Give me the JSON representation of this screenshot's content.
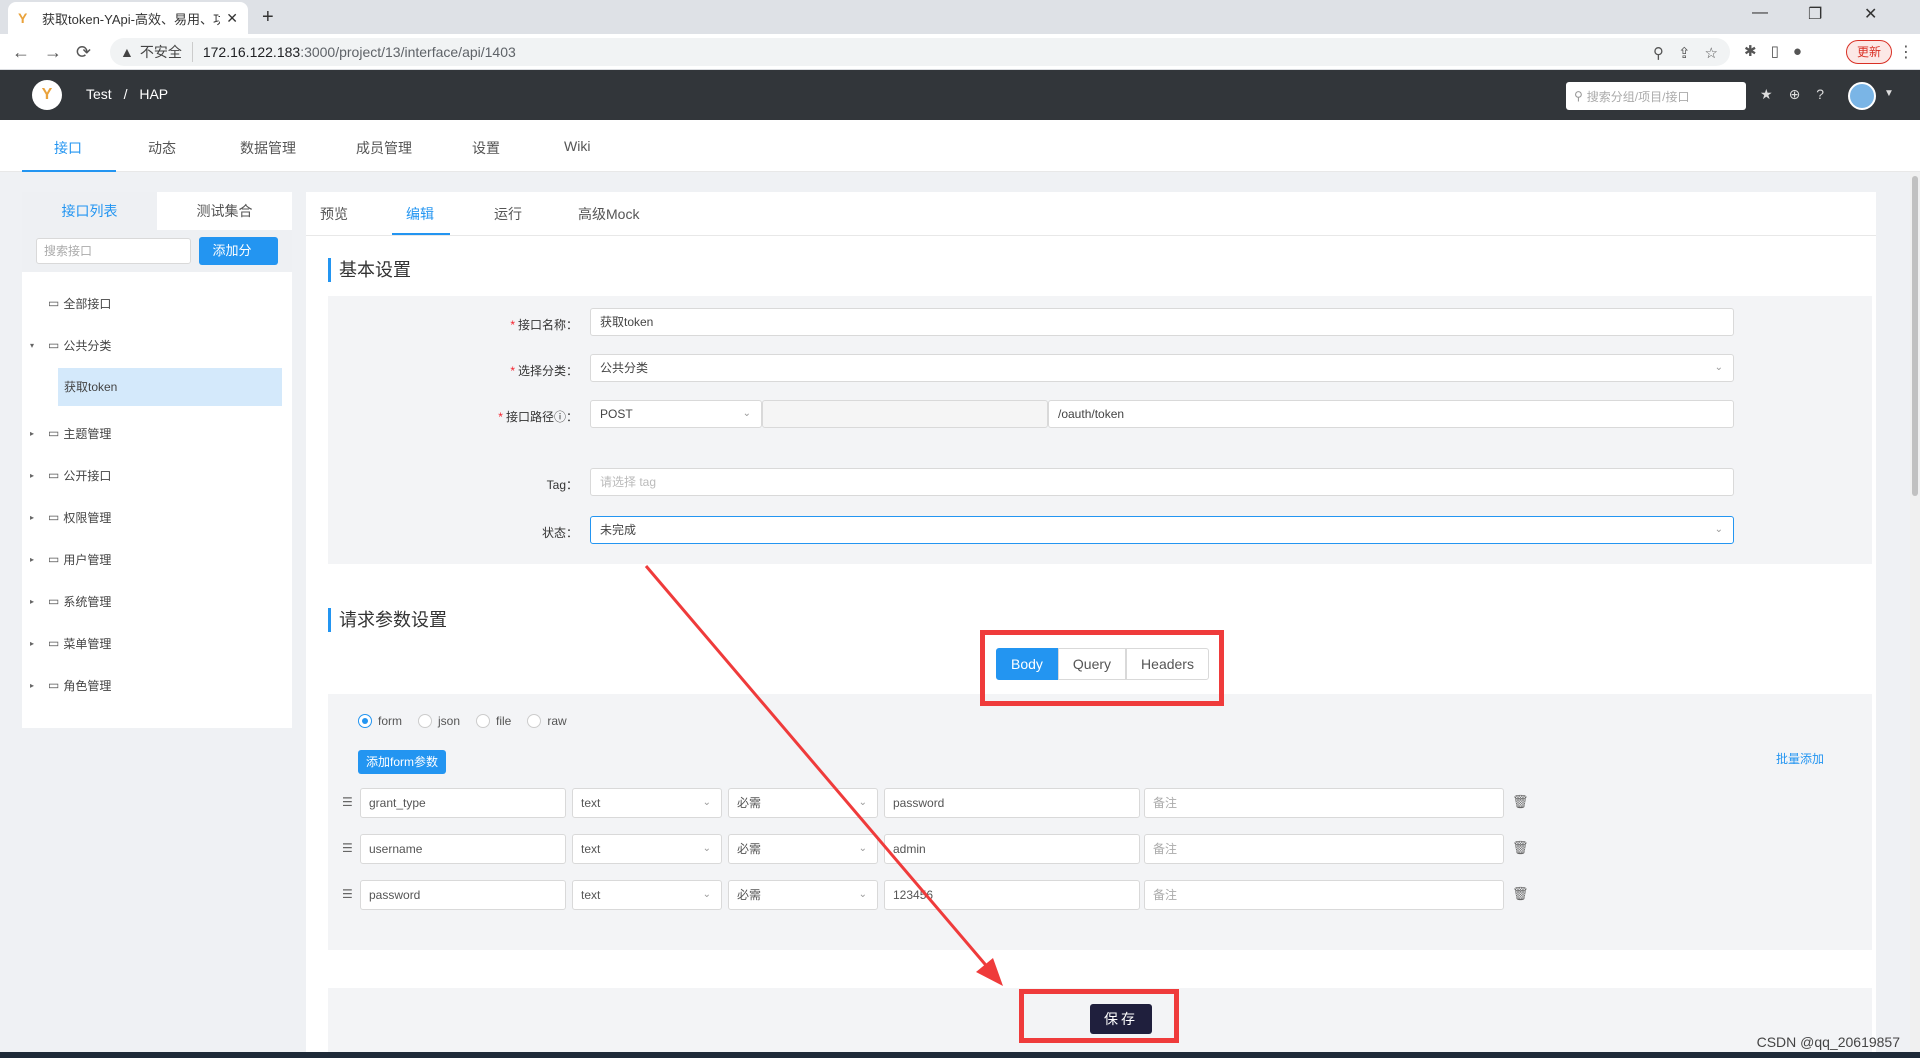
{
  "browser": {
    "tab_title": "获取token-YApi-高效、易用、功能强大的api管理平台",
    "tab_close": "✕",
    "new_tab": "+",
    "win_min": "—",
    "win_max": "❐",
    "win_close": "✕",
    "back": "←",
    "forward": "→",
    "reload": "⟳",
    "security_icon": "▲",
    "security_text": "不安全",
    "url_host": "172.16.122.183",
    "url_path": ":3000/project/13/interface/api/1403",
    "zoom_icon": "⚲",
    "share_icon": "⇪",
    "star_icon": "☆",
    "ext_icon": "✱",
    "side_icon": "▯",
    "profile_icon": "●",
    "update_label": "更新",
    "menu_icon": "⋮"
  },
  "app": {
    "logo": "Y",
    "breadcrumb_group": "Test",
    "breadcrumb_sep": "/",
    "breadcrumb_project": "HAP",
    "search_icon": "⚲",
    "search_placeholder": "搜索分组/项目/接口",
    "star_icon": "★",
    "add_icon": "⊕",
    "help_icon": "?",
    "caret": "▼"
  },
  "subnav": [
    "接口",
    "动态",
    "数据管理",
    "成员管理",
    "设置",
    "Wiki"
  ],
  "sidebar": {
    "tabs": [
      "接口列表",
      "测试集合"
    ],
    "search_placeholder": "搜索接口",
    "add_category": "添加分类",
    "folder_icon": "▭",
    "arrow": "▸",
    "arrow_open": "▾",
    "items": [
      "全部接口",
      "公共分类",
      "主题管理",
      "公开接口",
      "权限管理",
      "用户管理",
      "系统管理",
      "菜单管理",
      "角色管理"
    ],
    "selected_child": "获取token"
  },
  "main": {
    "tabs": [
      "预览",
      "编辑",
      "运行",
      "高级Mock"
    ],
    "basic_title": "基本设置",
    "required_mark": "*",
    "fields": {
      "name_label": "接口名称：",
      "name_value": "获取token",
      "category_label": "选择分类：",
      "category_value": "公共分类",
      "path_label": "接口路径",
      "path_help": "ⓘ",
      "path_colon": "：",
      "method_value": "POST",
      "path_prefix": "",
      "path_value": "/oauth/token",
      "tag_label": "Tag：",
      "tag_placeholder": "请选择 tag",
      "status_label": "状态：",
      "status_value": "未完成",
      "dropdown_icon": "⌄"
    },
    "request_title": "请求参数设置",
    "param_tabs": [
      "Body",
      "Query",
      "Headers"
    ],
    "body_types": [
      "form",
      "json",
      "file",
      "raw"
    ],
    "add_form_param": "添加form参数",
    "bulk_add": "批量添加",
    "drag_icon": "☰",
    "trash_icon": "🗑",
    "params": [
      {
        "name": "grant_type",
        "type": "text",
        "required": "必需",
        "example": "password",
        "note_placeholder": "备注"
      },
      {
        "name": "username",
        "type": "text",
        "required": "必需",
        "example": "admin",
        "note_placeholder": "备注"
      },
      {
        "name": "password",
        "type": "text",
        "required": "必需",
        "example": "123456",
        "note_placeholder": "备注"
      }
    ],
    "save_label": "保存"
  },
  "watermark": "CSDN @qq_20619857",
  "annotation_color": "#ef3b3b"
}
